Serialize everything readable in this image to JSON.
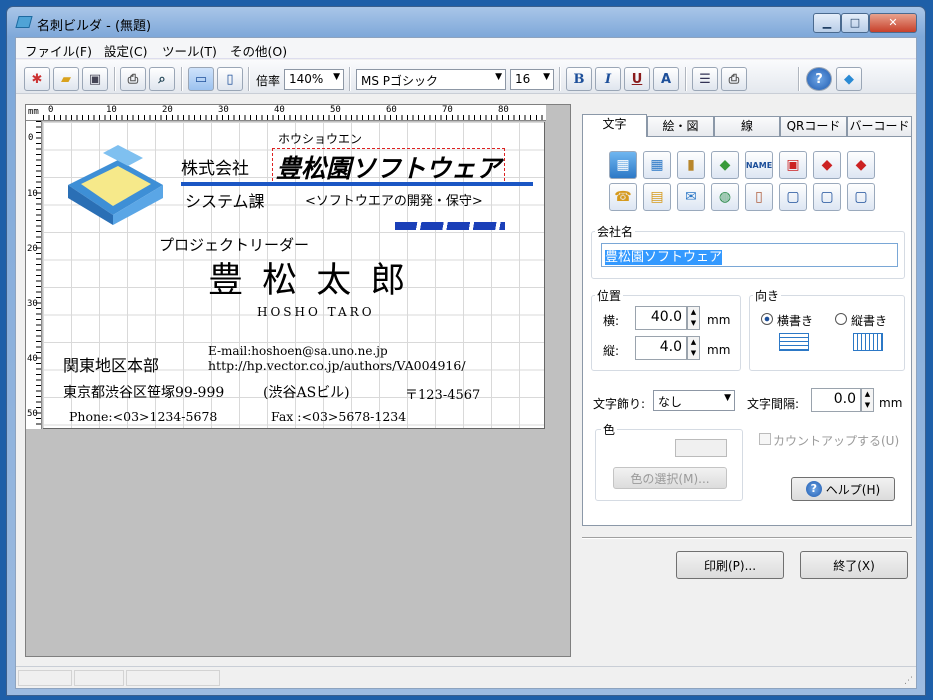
{
  "window": {
    "title": "名刺ビルダ - (無題)"
  },
  "menu": [
    "ファイル(F)",
    "設定(C)",
    "ツール(T)",
    "その他(O)"
  ],
  "toolbar": {
    "zoom_label": "倍率",
    "zoom_value": "140%",
    "font_value": "MS Pゴシック",
    "size_value": "16",
    "bold": "B",
    "italic": "I",
    "underline": "U",
    "color": "A"
  },
  "ruler": {
    "unit": "mm",
    "top": [
      "0",
      "10",
      "20",
      "30",
      "40",
      "50",
      "60",
      "70",
      "80"
    ],
    "left": [
      "0",
      "10",
      "20",
      "30",
      "40",
      "50"
    ]
  },
  "card": {
    "furigana": "ホウショウエン",
    "company_prefix": "株式会社",
    "company_name": "豊松園ソフトウェア",
    "department": "システム課",
    "slogan": "<ソフトウエアの開発・保守>",
    "title": "プロジェクトリーダー",
    "name": "豊 松 太 郎",
    "name_romaji": "HOSHO TARO",
    "email": "E-mail:hoshoen@sa.uno.ne.jp",
    "url": "http://hp.vector.co.jp/authors/VA004916/",
    "office": "関東地区本部",
    "address": "東京都渋谷区笹塚99-999",
    "building": "(渋谷ASビル)",
    "zip": "〒123-4567",
    "phone": "Phone:<03>1234-5678",
    "fax": "Fax :<03>5678-1234"
  },
  "panel": {
    "tabs": [
      "文字",
      "絵・図",
      "線",
      "QRコード",
      "バーコード"
    ],
    "company_label": "会社名",
    "company_value": "豊松園ソフトウェア",
    "position_label": "位置",
    "x_label": "横:",
    "x_value": "40.0",
    "y_label": "縦:",
    "y_value": "4.0",
    "unit_mm": "mm",
    "direction_label": "向き",
    "horizontal": "横書き",
    "vertical": "縦書き",
    "decoration_label": "文字飾り:",
    "decoration_value": "なし",
    "spacing_label": "文字間隔:",
    "spacing_value": "0.0",
    "color_label": "色",
    "color_button": "色の選択(M)...",
    "countup": "カウントアップする(U)",
    "help_button": "ヘルプ(H)"
  },
  "bottom": {
    "print_button": "印刷(P)...",
    "exit_button": "終了(X)"
  }
}
